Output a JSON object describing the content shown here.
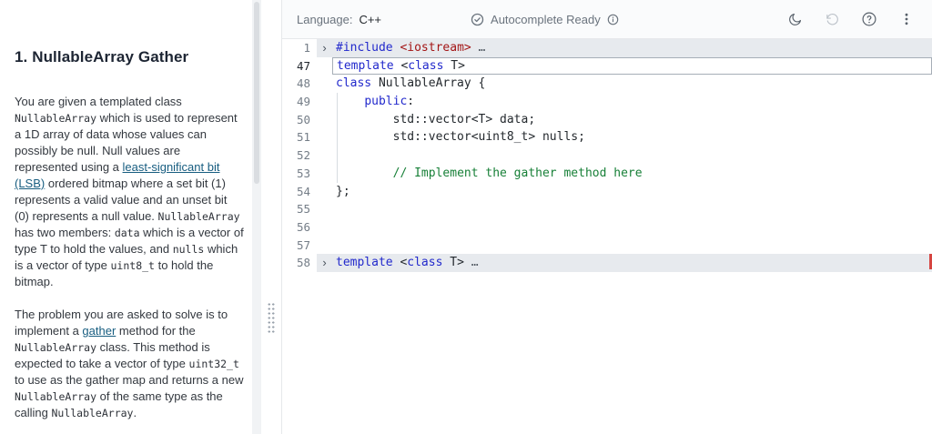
{
  "colors": {
    "keyword": "#2229cc",
    "string": "#a31515",
    "comment": "#188038",
    "link": "#175d80",
    "fold_bg": "#e7eaee",
    "marker_red": "#d64541"
  },
  "left_panel": {
    "title": "1. NullableArray Gather",
    "paragraphs": [
      [
        {
          "style": "text",
          "text": "You are given a templated class "
        },
        {
          "style": "code",
          "text": "NullableArray"
        },
        {
          "style": "text",
          "text": " which is used to represent a 1D array of data whose values can possibly be null. Null values are represented using a "
        },
        {
          "style": "link",
          "text": "least-significant bit (LSB)"
        },
        {
          "style": "text",
          "text": " ordered bitmap where a set bit (1) represents a valid value and an unset bit (0) represents a null value. "
        },
        {
          "style": "code",
          "text": "NullableArray"
        },
        {
          "style": "text",
          "text": " has two members: "
        },
        {
          "style": "code",
          "text": "data"
        },
        {
          "style": "text",
          "text": " which is a vector of type T to hold the values, and "
        },
        {
          "style": "code",
          "text": "nulls"
        },
        {
          "style": "text",
          "text": " which is a vector of type "
        },
        {
          "style": "code",
          "text": "uint8_t"
        },
        {
          "style": "text",
          "text": " to hold the bitmap."
        }
      ],
      [
        {
          "style": "text",
          "text": "The problem you are asked to solve is to implement a "
        },
        {
          "style": "link",
          "text": "gather"
        },
        {
          "style": "text",
          "text": " method for the "
        },
        {
          "style": "code",
          "text": "NullableArray"
        },
        {
          "style": "text",
          "text": " class. This method is expected to take a vector of type "
        },
        {
          "style": "code",
          "text": "uint32_t"
        },
        {
          "style": "text",
          "text": " to use as the gather map and returns a new "
        },
        {
          "style": "code",
          "text": "NullableArray"
        },
        {
          "style": "text",
          "text": " of the same type as the calling "
        },
        {
          "style": "code",
          "text": "NullableArray"
        },
        {
          "style": "text",
          "text": "."
        }
      ]
    ]
  },
  "toolbar": {
    "language_label": "Language:",
    "language_value": "C++",
    "autocomplete_status": "Autocomplete Ready",
    "icons": [
      "check-circle-icon",
      "info-icon",
      "dark-mode-icon",
      "history-icon",
      "help-icon",
      "kebab-menu-icon"
    ]
  },
  "editor": {
    "fold_icon_glyph": "›",
    "lines": [
      {
        "number": "1",
        "fold": true,
        "folded_bg": true,
        "tokens": [
          {
            "c": "kw",
            "t": "#include"
          },
          {
            "c": "plain",
            "t": " "
          },
          {
            "c": "str",
            "t": "<iostream>"
          },
          {
            "c": "ellipsis",
            "t": " …"
          }
        ]
      },
      {
        "number": "47",
        "boxed": true,
        "active": true,
        "tokens": [
          {
            "c": "kw",
            "t": "template"
          },
          {
            "c": "plain",
            "t": " <"
          },
          {
            "c": "kw",
            "t": "class"
          },
          {
            "c": "plain",
            "t": " T>"
          }
        ]
      },
      {
        "number": "48",
        "tokens": [
          {
            "c": "kw",
            "t": "class"
          },
          {
            "c": "plain",
            "t": " NullableArray {"
          }
        ]
      },
      {
        "number": "49",
        "guide": true,
        "tokens": [
          {
            "c": "plain",
            "t": "    "
          },
          {
            "c": "kw",
            "t": "public"
          },
          {
            "c": "plain",
            "t": ":"
          }
        ]
      },
      {
        "number": "50",
        "guide": true,
        "tokens": [
          {
            "c": "plain",
            "t": "        std::vector<T> data;"
          }
        ]
      },
      {
        "number": "51",
        "guide": true,
        "tokens": [
          {
            "c": "plain",
            "t": "        std::vector<uint8_t> nulls;"
          }
        ]
      },
      {
        "number": "52",
        "guide": true,
        "tokens": []
      },
      {
        "number": "53",
        "guide": true,
        "tokens": [
          {
            "c": "plain",
            "t": "        "
          },
          {
            "c": "comment",
            "t": "// Implement the gather method here"
          }
        ]
      },
      {
        "number": "54",
        "tokens": [
          {
            "c": "plain",
            "t": "};"
          }
        ]
      },
      {
        "number": "55",
        "tokens": []
      },
      {
        "number": "56",
        "tokens": []
      },
      {
        "number": "57",
        "tokens": []
      },
      {
        "number": "58",
        "fold": true,
        "folded_bg": true,
        "tokens": [
          {
            "c": "kw",
            "t": "template"
          },
          {
            "c": "plain",
            "t": " <"
          },
          {
            "c": "kw",
            "t": "class"
          },
          {
            "c": "plain",
            "t": " T>"
          },
          {
            "c": "ellipsis",
            "t": " …"
          }
        ]
      }
    ]
  }
}
